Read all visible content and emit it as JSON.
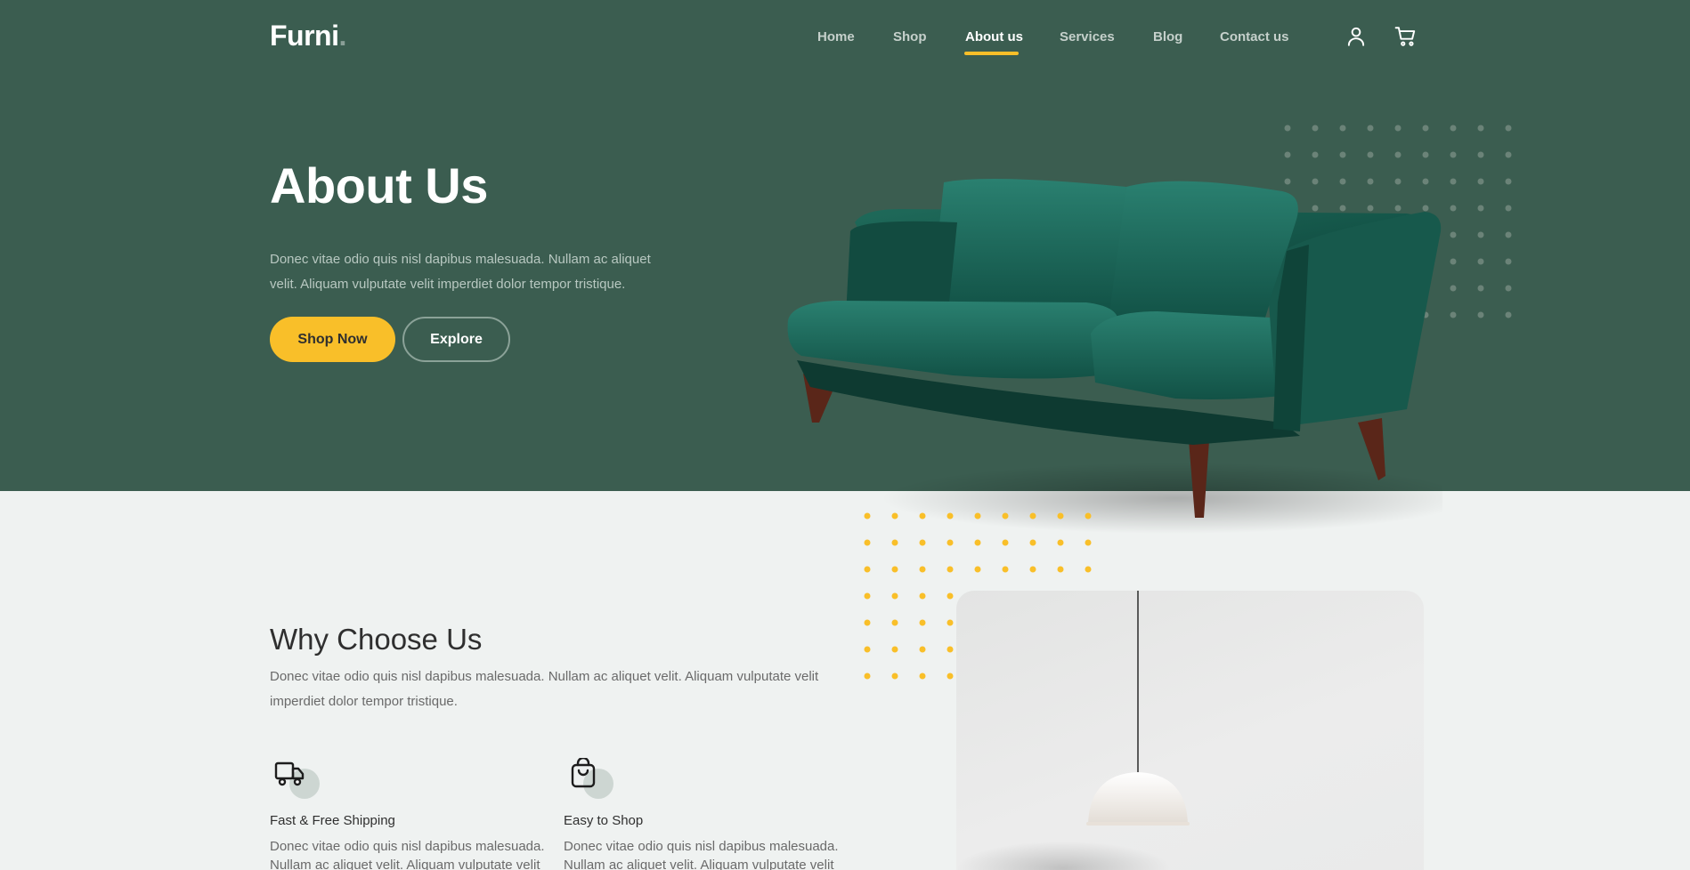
{
  "brand": {
    "name": "Furni",
    "dot": "."
  },
  "nav": {
    "items": [
      {
        "label": "Home",
        "active": false
      },
      {
        "label": "Shop",
        "active": false
      },
      {
        "label": "About us",
        "active": true
      },
      {
        "label": "Services",
        "active": false
      },
      {
        "label": "Blog",
        "active": false
      },
      {
        "label": "Contact us",
        "active": false
      }
    ],
    "icons": [
      "user-icon",
      "cart-icon"
    ]
  },
  "hero": {
    "title": "About Us",
    "text": "Donec vitae odio quis nisl dapibus malesuada. Nullam ac aliquet velit. Aliquam vulputate velit imperdiet dolor tempor tristique.",
    "primary_button": "Shop Now",
    "secondary_button": "Explore"
  },
  "why": {
    "title": "Why Choose Us",
    "text": "Donec vitae odio quis nisl dapibus malesuada. Nullam ac aliquet velit. Aliquam vulputate velit imperdiet dolor tempor tristique.",
    "features": [
      {
        "icon": "truck-icon",
        "title": "Fast & Free Shipping",
        "text": "Donec vitae odio quis nisl dapibus malesuada. Nullam ac aliquet velit. Aliquam vulputate velit imperdiet dolor tempor tristique."
      },
      {
        "icon": "bag-icon",
        "title": "Easy to Shop",
        "text": "Donec vitae odio quis nisl dapibus malesuada. Nullam ac aliquet velit. Aliquam vulputate velit imperdiet dolor tempor tristique."
      }
    ]
  },
  "colors": {
    "primary_green": "#3b5d50",
    "accent_yellow": "#f9bf29",
    "page_background": "#eff2f1"
  }
}
